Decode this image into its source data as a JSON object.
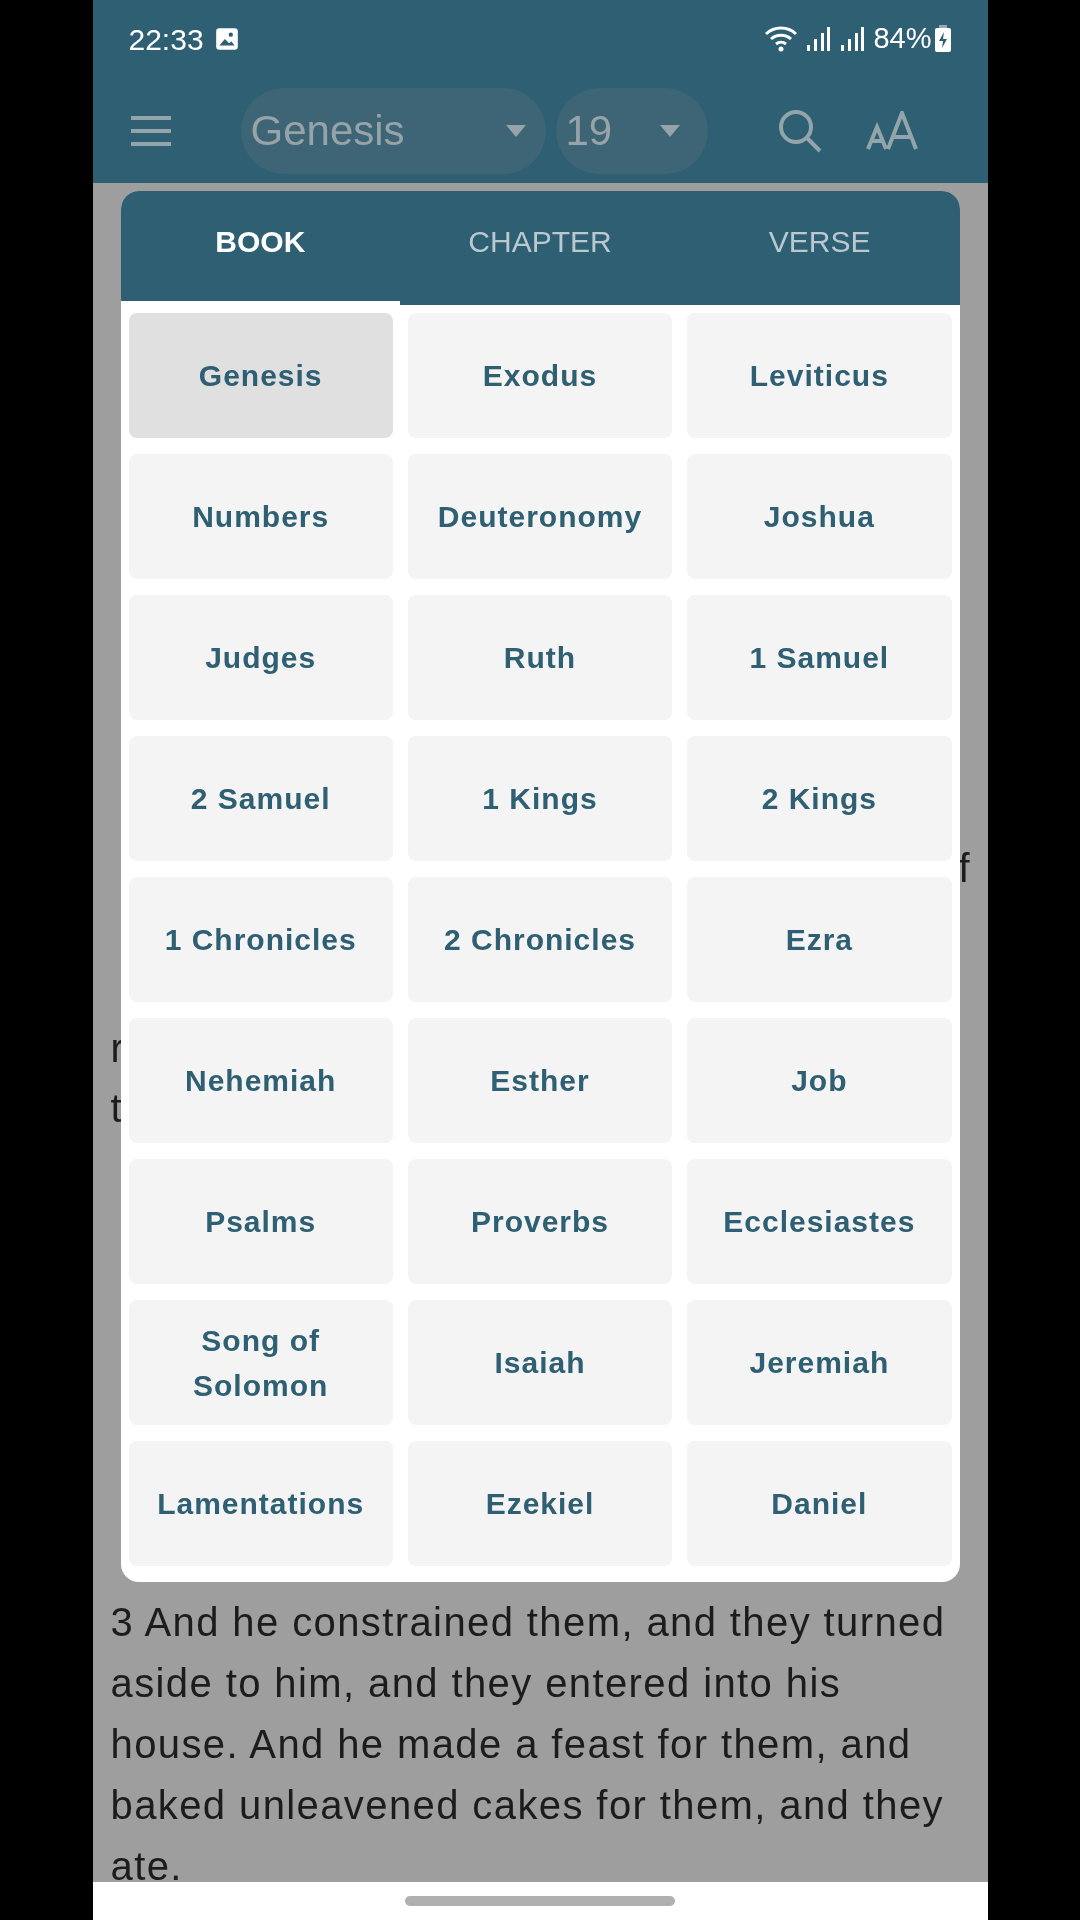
{
  "status_bar": {
    "time": "22:33",
    "battery": "84%"
  },
  "toolbar": {
    "book": "Genesis",
    "chapter": "19"
  },
  "background_text": {
    "left_edge": [
      "r",
      "t"
    ],
    "right_edge": "f",
    "verse": "3 And he constrained them, and they turned aside to him, and they entered into his house. And he made a feast for them, and baked unleavened cakes for them, and they ate."
  },
  "picker": {
    "tabs": [
      {
        "label": "BOOK",
        "selected": true
      },
      {
        "label": "CHAPTER",
        "selected": false
      },
      {
        "label": "VERSE",
        "selected": false
      }
    ],
    "books": [
      {
        "label": "Genesis",
        "selected": true
      },
      {
        "label": "Exodus",
        "selected": false
      },
      {
        "label": "Leviticus",
        "selected": false
      },
      {
        "label": "Numbers",
        "selected": false
      },
      {
        "label": "Deuteronomy",
        "selected": false
      },
      {
        "label": "Joshua",
        "selected": false
      },
      {
        "label": "Judges",
        "selected": false
      },
      {
        "label": "Ruth",
        "selected": false
      },
      {
        "label": "1 Samuel",
        "selected": false
      },
      {
        "label": "2 Samuel",
        "selected": false
      },
      {
        "label": "1 Kings",
        "selected": false
      },
      {
        "label": "2 Kings",
        "selected": false
      },
      {
        "label": "1 Chronicles",
        "selected": false
      },
      {
        "label": "2 Chronicles",
        "selected": false
      },
      {
        "label": "Ezra",
        "selected": false
      },
      {
        "label": "Nehemiah",
        "selected": false
      },
      {
        "label": "Esther",
        "selected": false
      },
      {
        "label": "Job",
        "selected": false
      },
      {
        "label": "Psalms",
        "selected": false
      },
      {
        "label": "Proverbs",
        "selected": false
      },
      {
        "label": "Ecclesiastes",
        "selected": false
      },
      {
        "label": "Song of Solomon",
        "selected": false
      },
      {
        "label": "Isaiah",
        "selected": false
      },
      {
        "label": "Jeremiah",
        "selected": false
      },
      {
        "label": "Lamentations",
        "selected": false
      },
      {
        "label": "Ezekiel",
        "selected": false
      },
      {
        "label": "Daniel",
        "selected": false
      }
    ]
  }
}
